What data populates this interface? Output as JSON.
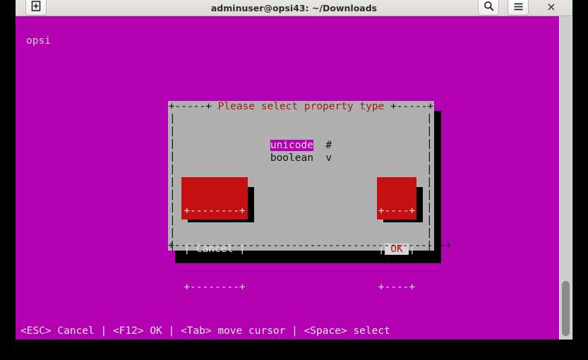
{
  "titlebar": {
    "title": "adminuser@opsi43: ~/Downloads",
    "new_tab_icon": "new-tab-icon",
    "search_icon": "search-icon",
    "menu_icon": "hamburger-menu-icon",
    "close_label": "×"
  },
  "terminal": {
    "prompt_text": "opsi",
    "background_color": "#b300b3",
    "foreground_color": "#c8c8c8",
    "statusbar_text": "<ESC> Cancel | <F12> OK | <Tab> move cursor | <Space> select"
  },
  "dialog": {
    "title": "Please select property type",
    "title_color": "#9e1919",
    "background_color": "#b0b0b0",
    "border_left_corner": "+-----+",
    "border_right_corner": "+-----+",
    "side_border_char": "|",
    "bottom_border": "+--------------------------------------------+",
    "options": [
      {
        "label": "unicode",
        "marker": "#",
        "selected": true
      },
      {
        "label": "boolean",
        "marker": "v",
        "selected": false
      }
    ],
    "buttons": [
      {
        "name": "cancel",
        "top_border": "+--------+",
        "label_line": "| Cancel |",
        "bottom_border": "+--------+",
        "label": "Cancel",
        "focused": false,
        "color": "#c41010"
      },
      {
        "name": "ok",
        "top_border": "+----+",
        "label_line": "|",
        "label_inner": " OK ",
        "label_line_end": "|",
        "bottom_border": "+----+",
        "label": "OK",
        "focused": true,
        "color": "#c41010",
        "focus_background": "#d6d6d6",
        "focus_color": "#b51010"
      }
    ]
  },
  "scrollbar": {
    "track_color": "#cdcdcd",
    "thumb_color": "#8a8a8a"
  }
}
